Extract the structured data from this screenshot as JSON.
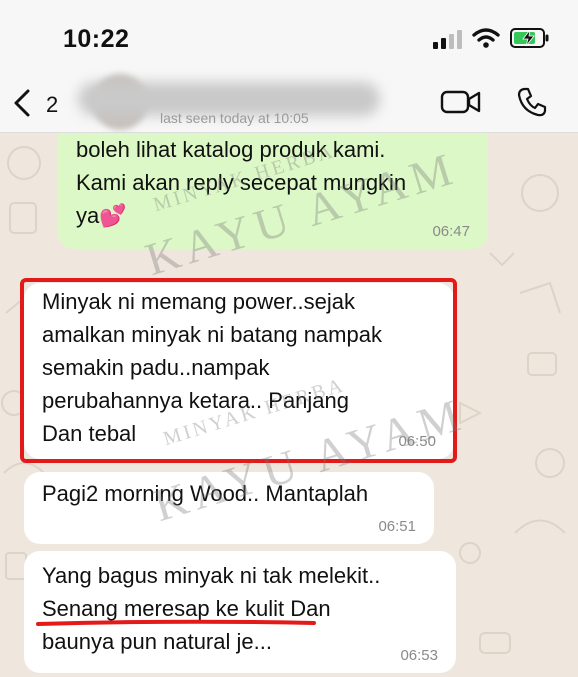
{
  "status_bar": {
    "time": "10:22"
  },
  "header": {
    "back_count": "2",
    "last_seen": "last seen today at 10:05"
  },
  "messages": [
    {
      "direction": "outgoing",
      "lines": [
        "boleh lihat katalog produk kami.",
        "Kami akan reply secepat mungkin",
        "ya💕"
      ],
      "time": "06:47"
    },
    {
      "direction": "incoming",
      "lines": [
        "Minyak ni memang power..sejak",
        "amalkan minyak ni batang nampak",
        "semakin padu..nampak",
        "perubahannya ketara.. Panjang",
        "Dan tebal"
      ],
      "time": "06:50",
      "highlighted": true
    },
    {
      "direction": "incoming",
      "lines": [
        "Pagi2 morning Wood.. Mantaplah"
      ],
      "time": "06:51"
    },
    {
      "direction": "incoming",
      "lines": [
        "Yang bagus minyak ni tak melekit..",
        "Senang meresap ke kulit Dan",
        "baunya pun natural je..."
      ],
      "time": "06:53",
      "underlined_text": "Senang meresap ke kulit"
    }
  ],
  "watermark": {
    "small": "MINYAK HERBA",
    "big": "KAYU AYAM"
  },
  "colors": {
    "outgoing_bubble": "#dcf8c6",
    "incoming_bubble": "#ffffff",
    "highlight": "#e31a1a",
    "wallpaper": "#efe7de"
  }
}
